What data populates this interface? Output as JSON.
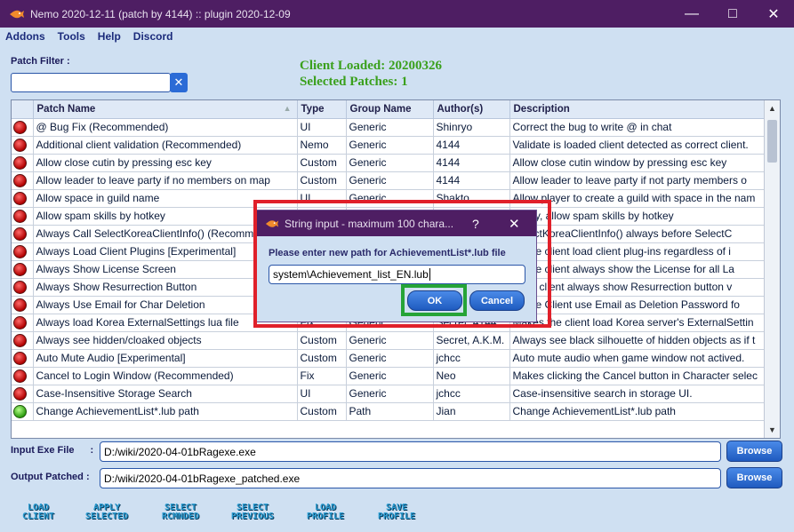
{
  "window": {
    "title": "Nemo 2020-12-11 (patch by 4144) :: plugin 2020-12-09",
    "app_icon": "nemo-fish-icon",
    "controls": [
      "minimize-icon",
      "maximize-icon",
      "close-icon"
    ]
  },
  "menu": [
    "Addons",
    "Tools",
    "Help",
    "Discord"
  ],
  "filter": {
    "label": "Patch Filter :",
    "value": "",
    "clear_icon": "clear-x-icon"
  },
  "status": {
    "client_loaded": "Client Loaded: 20200326",
    "selected_patches": "Selected Patches: 1"
  },
  "table": {
    "columns": [
      "Patch Name",
      "Type",
      "Group Name",
      "Author(s)",
      "Description"
    ],
    "rows": [
      {
        "state": "red",
        "name": "@ Bug Fix (Recommended)",
        "type": "UI",
        "group": "Generic",
        "author": "Shinryo",
        "desc": "Correct the bug to write @ in chat"
      },
      {
        "state": "red",
        "name": "Additional client validation (Recommended)",
        "type": "Nemo",
        "group": "Generic",
        "author": "4144",
        "desc": "Validate is loaded client detected as correct client."
      },
      {
        "state": "red",
        "name": "Allow close cutin by pressing esc key",
        "type": "Custom",
        "group": "Generic",
        "author": "4144",
        "desc": "Allow close cutin window by pressing esc key"
      },
      {
        "state": "red",
        "name": "Allow leader to leave party if no members on map",
        "type": "Custom",
        "group": "Generic",
        "author": "4144",
        "desc": "Allow leader to leave party if not party members o"
      },
      {
        "state": "red",
        "name": "Allow space in guild name",
        "type": "UI",
        "group": "Generic",
        "author": "Shakto",
        "desc": "Allow player to create a guild with space in the nam"
      },
      {
        "state": "red",
        "name": "Allow spam skills by hotkey",
        "type": "",
        "group": "",
        "author": "",
        "desc": "ld key, allow spam skills by hotkey"
      },
      {
        "state": "red",
        "name": "Always Call SelectKoreaClientInfo() (Recomm",
        "type": "",
        "group": "",
        "author": "",
        "desc": "SelectKoreaClientInfo() always before SelectC"
      },
      {
        "state": "red",
        "name": "Always Load Client Plugins [Experimental]",
        "type": "",
        "group": "",
        "author": "",
        "desc": "es the client load client plug-ins regardless of i"
      },
      {
        "state": "red",
        "name": "Always Show License Screen",
        "type": "",
        "group": "",
        "author": "",
        "desc": "es the client always show the License for all La"
      },
      {
        "state": "red",
        "name": "Always Show Resurrection Button",
        "type": "",
        "group": "",
        "author": "",
        "desc": "e the client always show Resurrection button v"
      },
      {
        "state": "red",
        "name": "Always Use Email for Char Deletion",
        "type": "",
        "group": "",
        "author": "",
        "desc": "es the Client use Email as Deletion Password fo"
      },
      {
        "state": "red",
        "name": "Always load Korea ExternalSettings lua file",
        "type": "Fix",
        "group": "Generic",
        "author": "Secret, 4144",
        "desc": "Makes the client load Korea server's ExternalSettin"
      },
      {
        "state": "red",
        "name": "Always see hidden/cloaked objects",
        "type": "Custom",
        "group": "Generic",
        "author": "Secret, A.K.M.",
        "desc": "Always see black silhouette of hidden objects as if t"
      },
      {
        "state": "red",
        "name": "Auto Mute Audio [Experimental]",
        "type": "Custom",
        "group": "Generic",
        "author": "jchcc",
        "desc": "Auto mute audio when game window not actived."
      },
      {
        "state": "red",
        "name": "Cancel to Login Window (Recommended)",
        "type": "Fix",
        "group": "Generic",
        "author": "Neo",
        "desc": "Makes clicking the Cancel button in Character selec"
      },
      {
        "state": "red",
        "name": "Case-Insensitive Storage Search",
        "type": "UI",
        "group": "Generic",
        "author": "jchcc",
        "desc": "Case-insensitive search in storage UI."
      },
      {
        "state": "green",
        "name": "Change AchievementList*.lub path",
        "type": "Custom",
        "group": "Path",
        "author": "Jian",
        "desc": "Change AchievementList*.lub path"
      }
    ]
  },
  "paths": {
    "input_label": "Input Exe File",
    "input_value": "D:/wiki/2020-04-01bRagexe.exe",
    "output_label": "Output Patched :",
    "output_value": "D:/wiki/2020-04-01bRagexe_patched.exe",
    "browse": "Browse"
  },
  "bottom_buttons": [
    {
      "line1": "LOAD",
      "line2": "CLIENT"
    },
    {
      "line1": "APPLY",
      "line2": "SELECTED"
    },
    {
      "line1": "SELECT",
      "line2": "RCMNDED"
    },
    {
      "line1": "SELECT",
      "line2": "PREVIOUS"
    },
    {
      "line1": "LOAD",
      "line2": "PROFILE"
    },
    {
      "line1": "SAVE",
      "line2": "PROFILE"
    }
  ],
  "dialog": {
    "title": "String input - maximum 100 chara...",
    "help": "?",
    "prompt": "Please enter new path for AchievementList*.lub file",
    "value": "system\\Achievement_list_EN.lub",
    "ok": "OK",
    "cancel": "Cancel"
  },
  "colors": {
    "titlebar": "#4e1e63",
    "background": "#cfe0f2",
    "status_green": "#3aa01c",
    "highlight_red": "#e0202a",
    "highlight_green": "#26a437"
  }
}
